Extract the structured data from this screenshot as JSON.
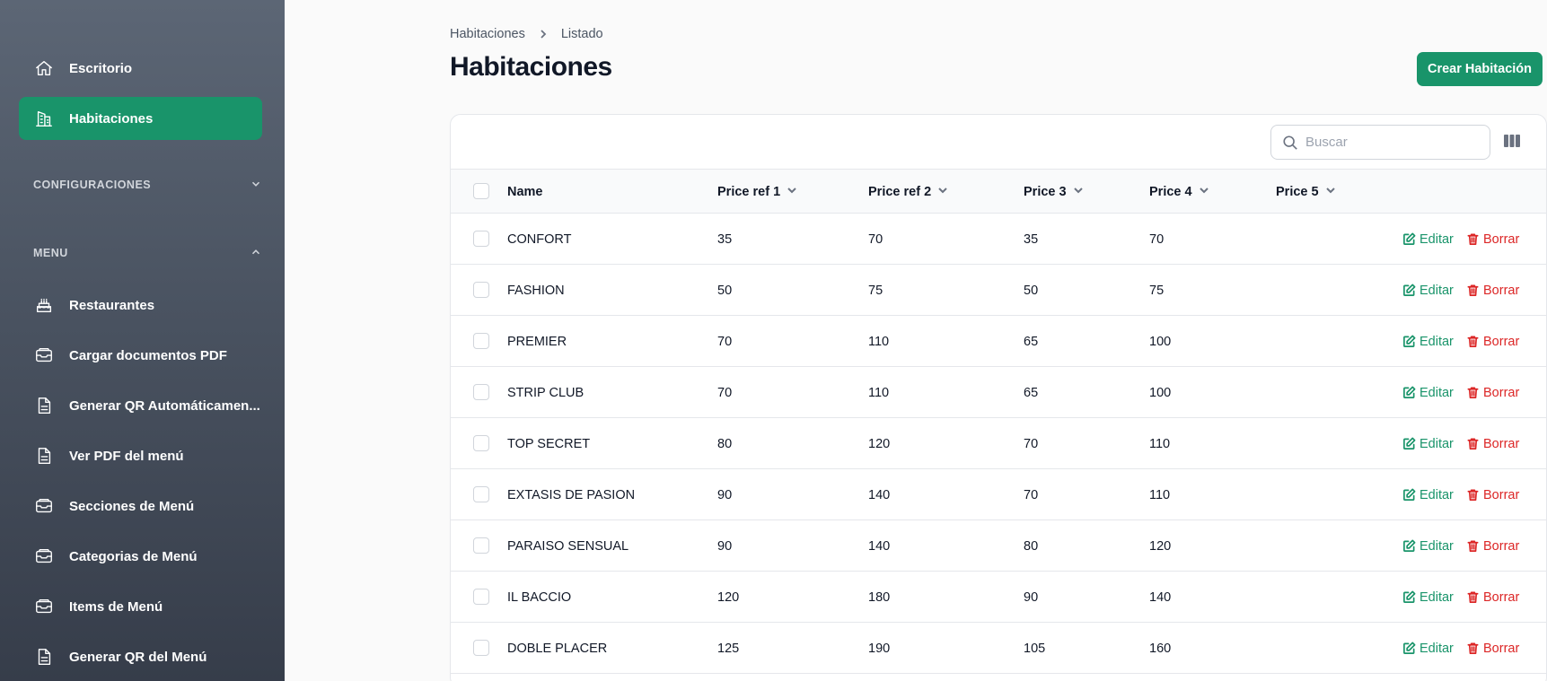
{
  "sidebar": {
    "top_items": [
      {
        "label": "Escritorio",
        "icon": "home-icon",
        "active": false
      },
      {
        "label": "Habitaciones",
        "icon": "building-icon",
        "active": true
      }
    ],
    "groups": [
      {
        "label": "CONFIGURACIONES",
        "expanded": false
      },
      {
        "label": "MENU",
        "expanded": true
      }
    ],
    "menu_items": [
      {
        "label": "Restaurantes",
        "icon": "cake-icon"
      },
      {
        "label": "Cargar documentos PDF",
        "icon": "inbox-icon"
      },
      {
        "label": "Generar QR Automáticamen...",
        "icon": "document-icon"
      },
      {
        "label": "Ver PDF del menú",
        "icon": "document-icon"
      },
      {
        "label": "Secciones de Menú",
        "icon": "inbox-icon"
      },
      {
        "label": "Categorias de Menú",
        "icon": "inbox-icon"
      },
      {
        "label": "Items de Menú",
        "icon": "inbox-icon"
      },
      {
        "label": "Generar QR del Menú",
        "icon": "document-icon"
      }
    ]
  },
  "breadcrumb": {
    "first": "Habitaciones",
    "second": "Listado"
  },
  "page": {
    "title": "Habitaciones",
    "create_label": "Crear Habitación"
  },
  "search": {
    "placeholder": "Buscar"
  },
  "table": {
    "columns": [
      "Name",
      "Price ref 1",
      "Price ref 2",
      "Price 3",
      "Price 4",
      "Price 5"
    ],
    "edit_label": "Editar",
    "delete_label": "Borrar",
    "rows": [
      {
        "name": "CONFORT",
        "p1": "35",
        "p2": "70",
        "p3": "35",
        "p4": "70",
        "p5": ""
      },
      {
        "name": "FASHION",
        "p1": "50",
        "p2": "75",
        "p3": "50",
        "p4": "75",
        "p5": ""
      },
      {
        "name": "PREMIER",
        "p1": "70",
        "p2": "110",
        "p3": "65",
        "p4": "100",
        "p5": ""
      },
      {
        "name": "STRIP CLUB",
        "p1": "70",
        "p2": "110",
        "p3": "65",
        "p4": "100",
        "p5": ""
      },
      {
        "name": "TOP SECRET",
        "p1": "80",
        "p2": "120",
        "p3": "70",
        "p4": "110",
        "p5": ""
      },
      {
        "name": "EXTASIS DE PASION",
        "p1": "90",
        "p2": "140",
        "p3": "70",
        "p4": "110",
        "p5": ""
      },
      {
        "name": "PARAISO SENSUAL",
        "p1": "90",
        "p2": "140",
        "p3": "80",
        "p4": "120",
        "p5": ""
      },
      {
        "name": "IL BACCIO",
        "p1": "120",
        "p2": "180",
        "p3": "90",
        "p4": "140",
        "p5": ""
      },
      {
        "name": "DOBLE PLACER",
        "p1": "125",
        "p2": "190",
        "p3": "105",
        "p4": "160",
        "p5": ""
      }
    ]
  },
  "colors": {
    "accent": "#19946a",
    "danger": "#dc2626"
  }
}
